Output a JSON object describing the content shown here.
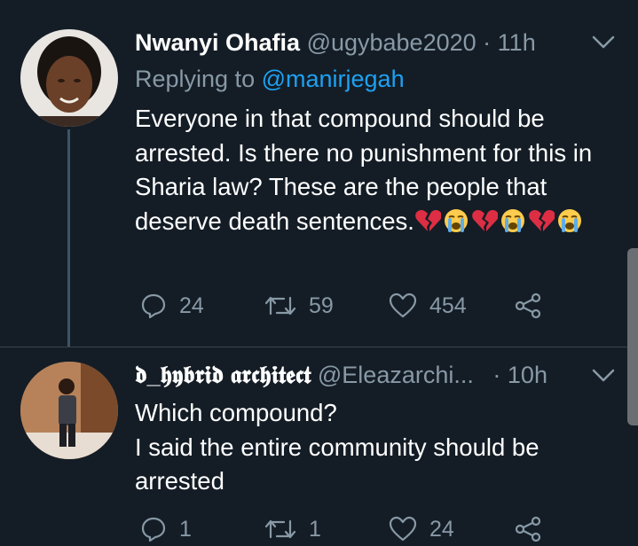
{
  "tweets": [
    {
      "name": "Nwanyi Ohafia",
      "handle": "@ugybabe2020",
      "separator": "·",
      "time": "11h",
      "replying_prefix": "Replying to",
      "replying_to": "@manirjegah",
      "body": "Everyone in that compound should be arrested. Is there no punishment for this in Sharia law? These are the people that deserve death sentences.",
      "emojis": [
        "broken-heart",
        "crying-face",
        "broken-heart",
        "crying-face",
        "broken-heart",
        "crying-face"
      ],
      "replies": "24",
      "retweets": "59",
      "likes": "454"
    },
    {
      "name": "𝖉_𝖍𝖞𝖇𝖗𝖎𝖉 𝖆𝖗𝖈𝖍𝖎𝖙𝖊𝖈𝖙",
      "handle": "@Eleazarchi...",
      "separator": "·",
      "time": "10h",
      "body_line1": "Which compound?",
      "body_line2": "I said the entire community should be arrested",
      "replies": "1",
      "retweets": "1",
      "likes": "24"
    }
  ],
  "colors": {
    "background": "#141d26",
    "muted": "#8899a6",
    "link": "#1da1f2",
    "thread_line": "#3d5466"
  },
  "icons": [
    "reply-icon",
    "retweet-icon",
    "like-icon",
    "share-icon",
    "chevron-down-icon",
    "broken-heart-emoji",
    "crying-face-emoji"
  ]
}
